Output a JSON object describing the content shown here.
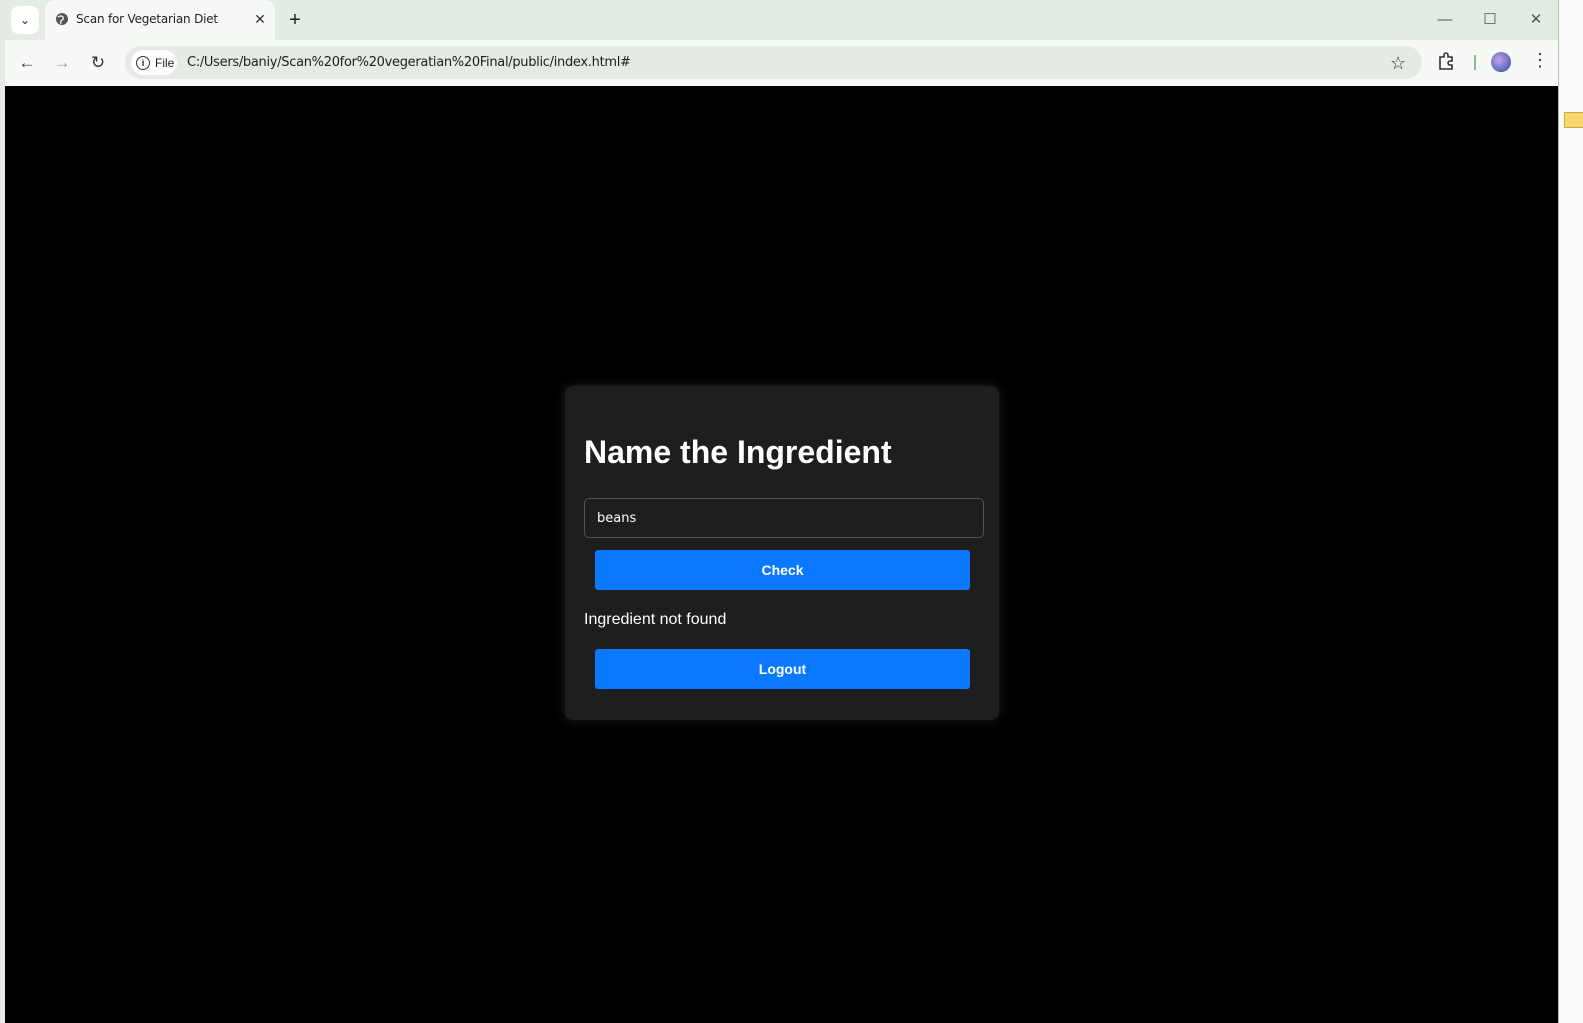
{
  "browser": {
    "tab_title": "Scan for Vegetarian Diet",
    "site_info_label": "File",
    "url": "C:/Users/baniy/Scan%20for%20vegeratian%20Final/public/index.html#"
  },
  "app": {
    "heading": "Name the Ingredient",
    "input_value": "beans",
    "check_label": "Check",
    "result_text": "Ingredient not found",
    "logout_label": "Logout"
  },
  "colors": {
    "accent": "#0a78ff",
    "card_bg": "#1e1e1e",
    "page_bg": "#000000"
  }
}
